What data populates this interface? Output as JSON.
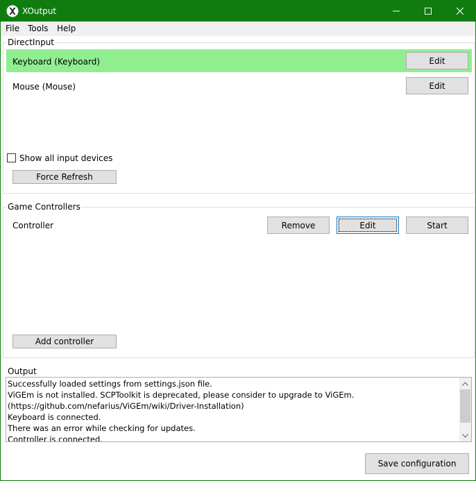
{
  "window": {
    "title": "XOutput",
    "accent": "#107c10"
  },
  "menu": {
    "file": "File",
    "tools": "Tools",
    "help": "Help"
  },
  "direct_input": {
    "title": "DirectInput",
    "selected_color": "#90ee90",
    "devices": [
      {
        "label": "Keyboard (Keyboard)",
        "edit_label": "Edit",
        "selected": true
      },
      {
        "label": "Mouse (Mouse)",
        "edit_label": "Edit",
        "selected": false
      }
    ],
    "show_all_label": "Show all input devices",
    "show_all_checked": false,
    "force_refresh_label": "Force Refresh"
  },
  "game_controllers": {
    "title": "Game Controllers",
    "controllers": [
      {
        "label": "Controller",
        "remove_label": "Remove",
        "edit_label": "Edit",
        "start_label": "Start"
      }
    ],
    "add_label": "Add controller"
  },
  "output": {
    "title": "Output",
    "lines": [
      "Successfully loaded settings from settings.json file.",
      "ViGEm is not installed. SCPToolkit is deprecated, please consider to upgrade to ViGEm. (https://github.com/nefarius/ViGEm/wiki/Driver-Installation)",
      "Keyboard is connected.",
      "There was an error while checking for updates.",
      "Controller is connected."
    ]
  },
  "footer": {
    "save_label": "Save configuration"
  }
}
